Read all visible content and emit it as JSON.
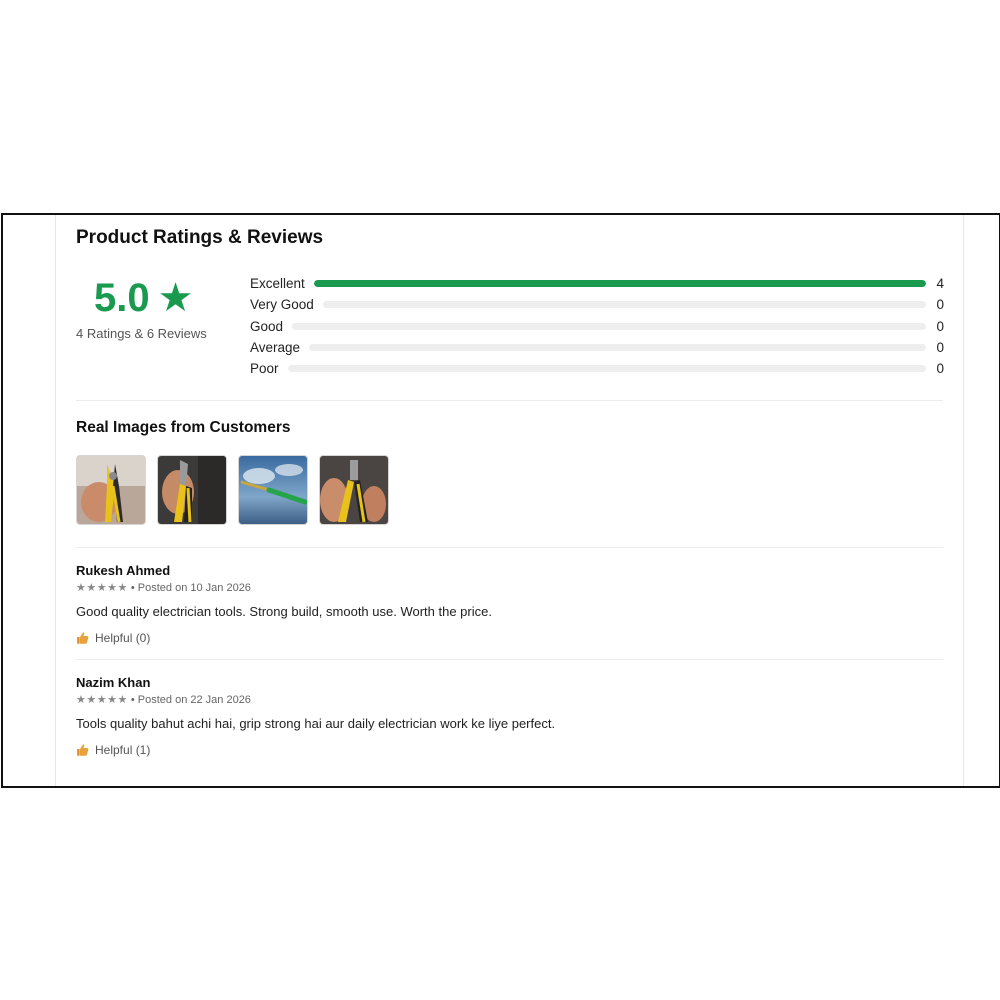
{
  "header": {
    "title": "Product Ratings & Reviews"
  },
  "summary": {
    "score": "5.0",
    "star": "★",
    "subtitle": "4 Ratings & 6 Reviews"
  },
  "distribution": [
    {
      "label": "Excellent",
      "count": "4",
      "fraction": 1.0
    },
    {
      "label": "Very Good",
      "count": "0",
      "fraction": 0
    },
    {
      "label": "Good",
      "count": "0",
      "fraction": 0
    },
    {
      "label": "Average",
      "count": "0",
      "fraction": 0
    },
    {
      "label": "Poor",
      "count": "0",
      "fraction": 0
    }
  ],
  "colors": {
    "accent": "#1a9a4f",
    "track": "#eeeeee"
  },
  "customer_images": {
    "title": "Real Images from Customers",
    "items": [
      {
        "icon": "pliers-photo-1"
      },
      {
        "icon": "pliers-photo-2"
      },
      {
        "icon": "screwdriver-tester-photo"
      },
      {
        "icon": "pliers-photo-3"
      }
    ]
  },
  "reviews": [
    {
      "name": "Rukesh Ahmed",
      "stars": "★★★★★",
      "posted": "• Posted on 10 Jan 2026",
      "text": "Good quality electrician tools. Strong build, smooth use. Worth the price.",
      "helpful_icon": "thumbs-up-icon",
      "helpful": "Helpful (0)"
    },
    {
      "name": "Nazim Khan",
      "stars": "★★★★★",
      "posted": "• Posted on 22 Jan 2026",
      "text": "Tools quality bahut achi hai, grip strong hai aur daily electrician work ke liye perfect.",
      "helpful_icon": "thumbs-up-icon",
      "helpful": "Helpful (1)"
    }
  ]
}
